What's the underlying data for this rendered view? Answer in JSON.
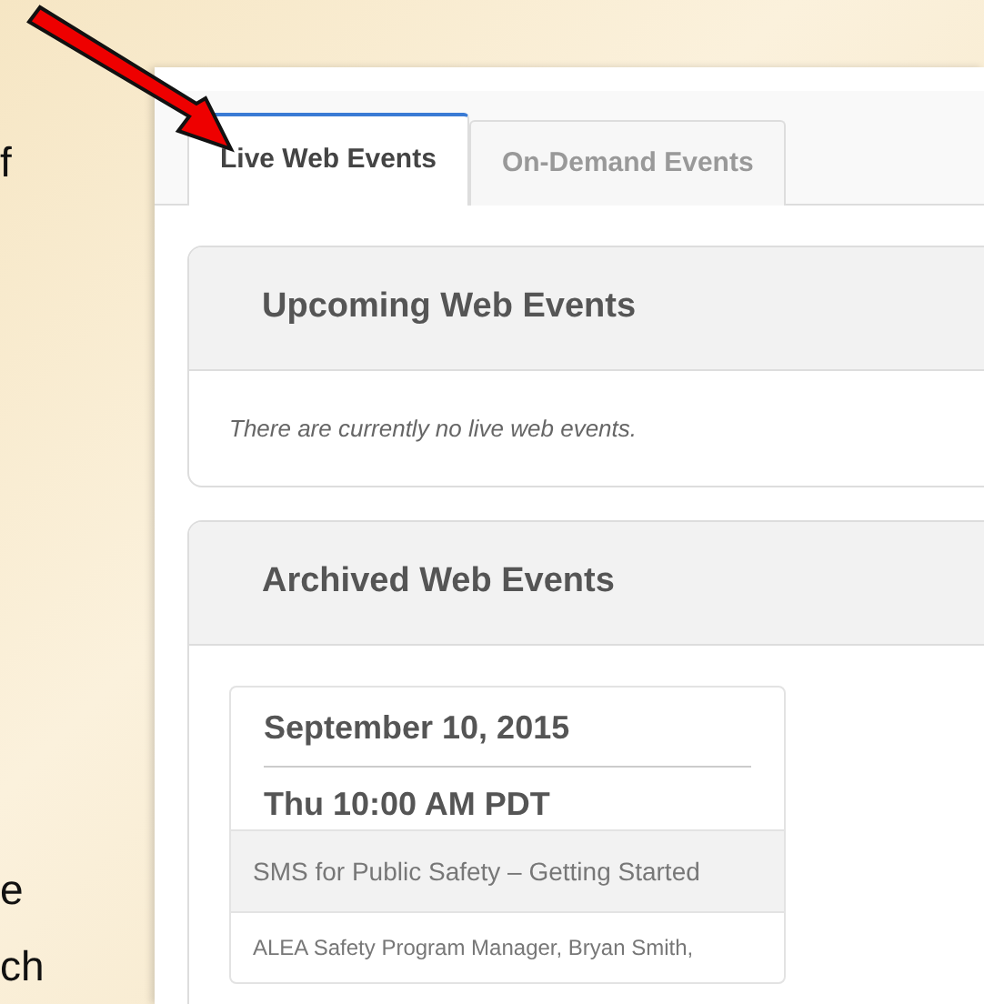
{
  "slide_text": [
    "f",
    "e",
    "ch"
  ],
  "tabs": [
    {
      "label": "Live Web Events",
      "selected": true
    },
    {
      "label": "On-Demand Events",
      "selected": false
    }
  ],
  "panels": [
    {
      "title": "Upcoming Web Events",
      "message": "There are currently no live web events."
    },
    {
      "title": "Archived Web Events",
      "events": [
        {
          "date": "September 10, 2015",
          "time": "Thu 10:00 AM PDT",
          "title": "SMS for Public Safety – Getting Started",
          "presenter": "ALEA Safety Program Manager, Bryan Smith,"
        }
      ]
    }
  ]
}
